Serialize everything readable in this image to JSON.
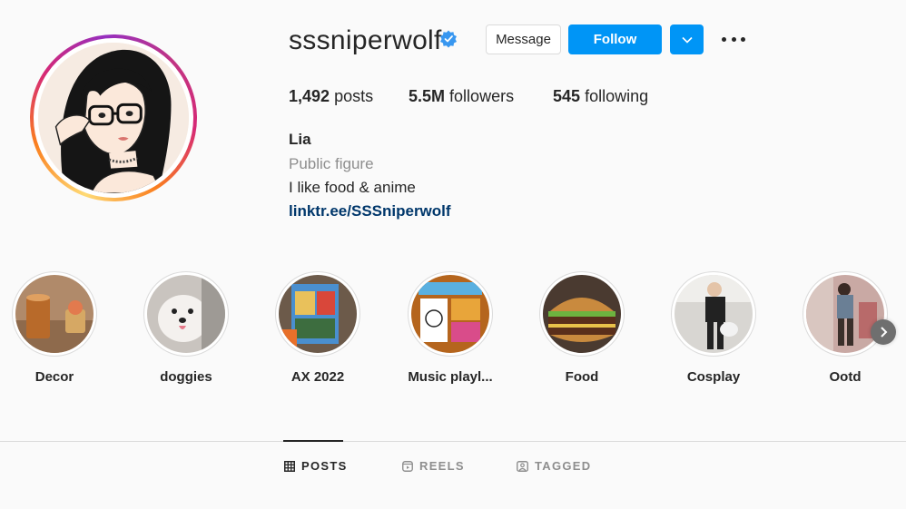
{
  "profile": {
    "username": "sssniperwolf",
    "verified": true,
    "message_label": "Message",
    "follow_label": "Follow",
    "dropdown_icon": "chevron-down-icon",
    "more_icon": "more-options-icon"
  },
  "stats": {
    "posts_count": "1,492",
    "posts_label": "posts",
    "followers_count": "5.5M",
    "followers_label": "followers",
    "following_count": "545",
    "following_label": "following"
  },
  "bio": {
    "name": "Lia",
    "category": "Public figure",
    "text": "I like food & anime",
    "link": "linktr.ee/SSSniperwolf"
  },
  "highlights": [
    {
      "label": "Decor"
    },
    {
      "label": "doggies"
    },
    {
      "label": "AX 2022"
    },
    {
      "label": "Music playl..."
    },
    {
      "label": "Food"
    },
    {
      "label": "Cosplay"
    },
    {
      "label": "Ootd"
    }
  ],
  "tabs": [
    {
      "label": "POSTS",
      "icon": "grid-icon",
      "active": true
    },
    {
      "label": "REELS",
      "icon": "reels-icon",
      "active": false
    },
    {
      "label": "TAGGED",
      "icon": "tagged-icon",
      "active": false
    }
  ],
  "colors": {
    "accent_blue": "#0095f6",
    "link_color": "#00376b",
    "muted_text": "#8e8e8e",
    "border": "#dbdbdb"
  }
}
